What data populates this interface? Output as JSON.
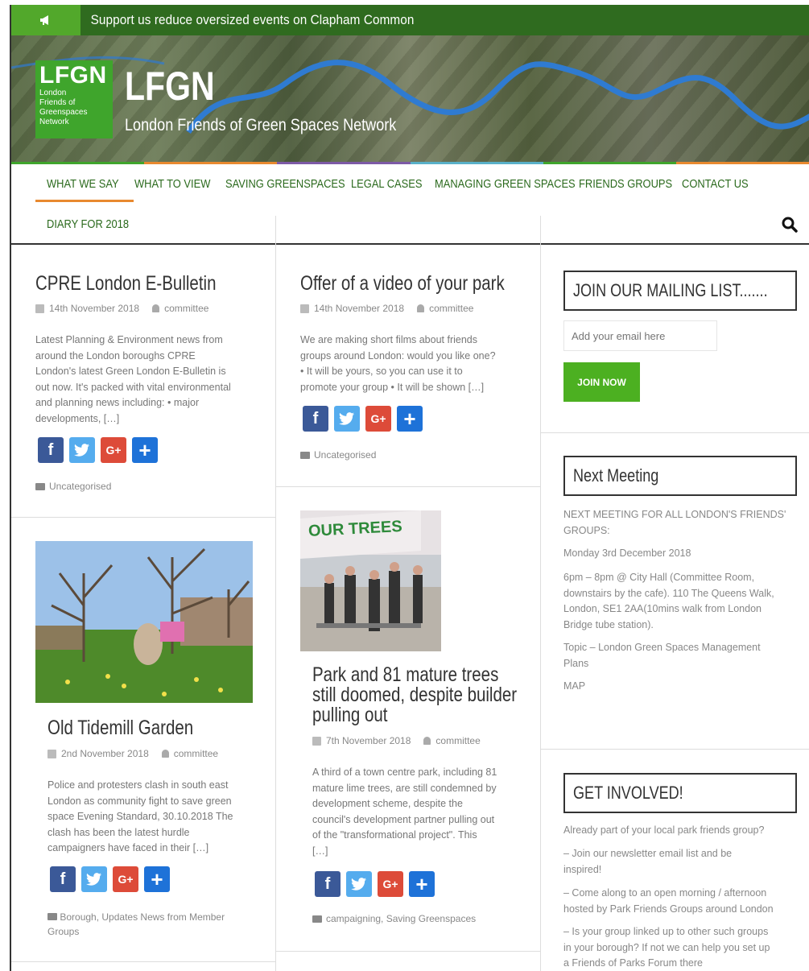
{
  "announcement": {
    "icon": "megaphone-icon",
    "text": "Support us reduce oversized events on Clapham Common"
  },
  "site": {
    "logo_big": "LFGN",
    "logo_small": [
      "London",
      "Friends of",
      "Greenspaces",
      "Network"
    ],
    "title": "LFGN",
    "description": "London Friends of Green Spaces Network"
  },
  "nav": {
    "items": [
      "WHAT WE SAY",
      "WHAT TO VIEW",
      "SAVING GREENSPACES",
      "LEGAL CASES",
      "MANAGING GREEN SPACES",
      "FRIENDS GROUPS",
      "CONTACT US",
      "DIARY FOR 2018"
    ],
    "active": "WHAT WE SAY",
    "search_icon": "search-icon"
  },
  "colors": {
    "brand_green": "#2f6b1f",
    "accent_green": "#4cb021",
    "active_underline": "#e8892f"
  },
  "posts": [
    {
      "title": "CPRE London E-Bulletin",
      "date": "14th November 2018",
      "author": "committee",
      "excerpt": [
        "Latest Planning & Environment news from",
        "around the London boroughs  CPRE",
        "London's latest Green London E-Bulletin is",
        "out now. It's packed with vital environmental",
        "and planning news including: • major",
        "developments, […]"
      ],
      "categories": "Uncategorised"
    },
    {
      "title": "Offer of a video of your park",
      "date": "14th November 2018",
      "author": "committee",
      "excerpt": [
        "We are making short films about friends",
        "groups around London: would you like one?",
        "• It will be yours, so you can use it to",
        "promote your group • It will be shown […]"
      ],
      "categories": "Uncategorised"
    },
    {
      "title": "Old Tidemill Garden",
      "date": "2nd November 2018",
      "author": "committee",
      "excerpt": [
        "Police and protesters clash in south east",
        "London as community fight to save green",
        "space Evening Standard, 30.10.2018 The",
        "clash has been the latest hurdle",
        "campaigners have faced in their […]"
      ],
      "categories": [
        "Borough, Updates News from Member",
        "Groups"
      ]
    },
    {
      "title": [
        "Park and 81 mature trees",
        "still doomed, despite builder",
        "pulling out"
      ],
      "date": "7th November 2018",
      "author": "committee",
      "image_banner": "OUR TREES",
      "excerpt": [
        "A third of a town centre park, including 81",
        "mature lime trees, are still condemned by",
        "development scheme, despite the",
        "council's development partner pulling out",
        "of the \"transformational project\".  This",
        "[…]"
      ],
      "categories": "campaigning, Saving Greenspaces"
    }
  ],
  "share": {
    "facebook": "f",
    "twitter": "t",
    "google": "G+",
    "more": "+"
  },
  "sidebar": {
    "mailing": {
      "title": "JOIN OUR MAILING LIST.......",
      "placeholder": "Add your email here",
      "button": "JOIN NOW"
    },
    "meeting": {
      "title": "Next Meeting",
      "lines": [
        [
          "NEXT MEETING FOR ALL LONDON'S FRIENDS'",
          "GROUPS:"
        ],
        [
          "Monday 3rd December 2018"
        ],
        [
          "6pm – 8pm @ City Hall (Committee Room,",
          "downstairs by the cafe). 110 The Queens Walk,",
          "London, SE1 2AA(10mins walk from London",
          "Bridge tube station)."
        ],
        [
          "Topic – London Green Spaces Management",
          "Plans"
        ],
        [
          "MAP"
        ]
      ]
    },
    "involved": {
      "title": "GET INVOLVED!",
      "lines": [
        [
          "Already part of your local park friends group?"
        ],
        [
          "– Join our newsletter email list and be",
          "inspired!"
        ],
        [
          "– Come along to an open morning / afternoon",
          "hosted by Park Friends Groups around London"
        ],
        [
          "– Is your group linked up to other such groups",
          "in your borough? If not we can help you set up",
          "a Friends of Parks Forum there"
        ]
      ]
    }
  }
}
